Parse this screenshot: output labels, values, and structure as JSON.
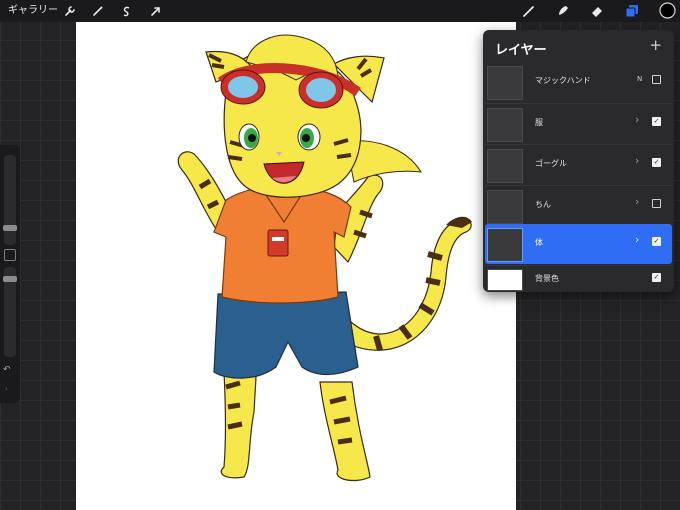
{
  "toolbar": {
    "gallery_label": "ギャラリー",
    "left_icons": [
      "wrench-icon",
      "magic-wand-icon",
      "selection-icon",
      "transform-arrow-icon"
    ],
    "right_icons": [
      "brush-icon",
      "smudge-icon",
      "eraser-icon",
      "layers-icon",
      "color-swatch-icon"
    ],
    "accent_color": "#2f6df4",
    "current_color": "#000000"
  },
  "sidebar": {
    "undo_icon": "undo-icon",
    "redo_icon": "redo-icon"
  },
  "layers_panel": {
    "title": "レイヤー",
    "add_label": "+",
    "layers": [
      {
        "name": "マジックハンド",
        "mode": "N",
        "visible": false,
        "active": false
      },
      {
        "name": "服",
        "mode": "",
        "visible": true,
        "active": false
      },
      {
        "name": "ゴーグル",
        "mode": "",
        "visible": true,
        "active": false
      },
      {
        "name": "ちん",
        "mode": "",
        "visible": false,
        "active": false
      },
      {
        "name": "体",
        "mode": "",
        "visible": true,
        "active": true
      },
      {
        "name": "背景色",
        "mode": "",
        "visible": true,
        "active": false
      }
    ]
  }
}
